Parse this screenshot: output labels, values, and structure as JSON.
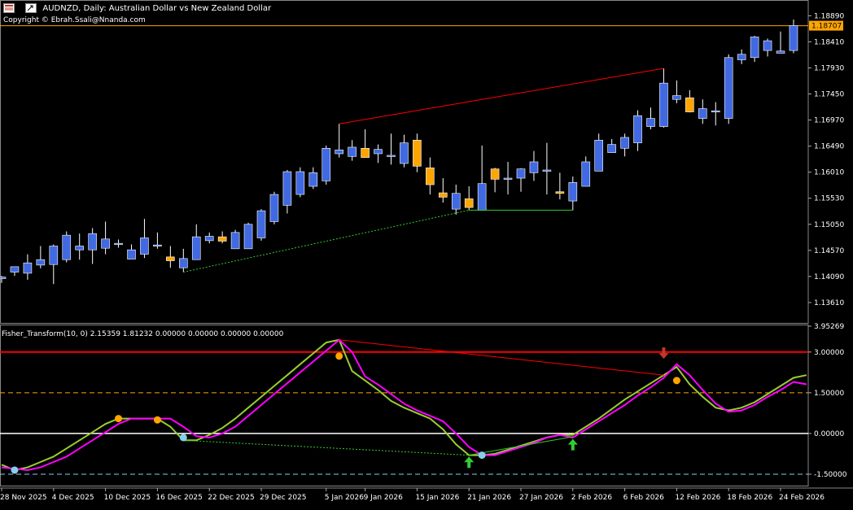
{
  "header": {
    "symbol": "AUDNZD",
    "timeframe": "Daily",
    "description": "Australian Dollar vs New Zealand Dollar",
    "title_line": "AUDNZD, Daily:  Australian Dollar vs New Zealand Dollar",
    "copyright": "Copyright © Ebrah.Ssali@Nnanda.com",
    "window_icon": "chart-window-icon",
    "restore_icon": "restore-window-icon"
  },
  "indicator_header": "Fisher_Transform(10, 0) 2.15359 1.81232 0.00000 0.00000 0.00000 0.00000",
  "colors": {
    "background": "#000000",
    "bull_candle": "#4169E1",
    "bear_candle": "#FFA500",
    "wick": "#FFFFFF",
    "price_line": "#FFA500",
    "fisher_line": "#9ACD32",
    "signal_line": "#FF00FF",
    "level_top": "#FF0000",
    "level_mid": "#FFA500",
    "level_zero": "#FFFFFF",
    "level_bottom": "#87CEEB",
    "divergence_bear": "#FF0000",
    "divergence_bull": "#32CD32",
    "dot_orange": "#FFA500",
    "dot_blue": "#87CEEB",
    "arrow_up": "#32CD32",
    "arrow_down": "#C0392B"
  },
  "chart_data": [
    {
      "type": "candlestick",
      "title": "AUDNZD, Daily",
      "current_price": "1.18707",
      "price_axis_ticks": [
        "1.18890",
        "1.18410",
        "1.17930",
        "1.17450",
        "1.16970",
        "1.16490",
        "1.16010",
        "1.15530",
        "1.15050",
        "1.14570",
        "1.14090",
        "1.13610"
      ],
      "ylim": [
        1.1322,
        1.1915
      ],
      "date_axis_ticks": [
        "28 Nov 2025",
        "4 Dec 2025",
        "10 Dec 2025",
        "16 Dec 2025",
        "22 Dec 2025",
        "29 Dec 2025",
        "5 Jan 2026",
        "9 Jan 2026",
        "15 Jan 2026",
        "21 Jan 2026",
        "27 Jan 2026",
        "2 Feb 2026",
        "6 Feb 2026",
        "12 Feb 2026",
        "18 Feb 2026",
        "24 Feb 2026"
      ],
      "candles": [
        {
          "o": 1.1405,
          "h": 1.141,
          "l": 1.1397,
          "c": 1.1408
        },
        {
          "o": 1.1417,
          "h": 1.1427,
          "l": 1.141,
          "c": 1.1427
        },
        {
          "o": 1.1415,
          "h": 1.145,
          "l": 1.1403,
          "c": 1.1434
        },
        {
          "o": 1.143,
          "h": 1.1465,
          "l": 1.1424,
          "c": 1.144
        },
        {
          "o": 1.1431,
          "h": 1.1468,
          "l": 1.1395,
          "c": 1.1465
        },
        {
          "o": 1.144,
          "h": 1.1492,
          "l": 1.1435,
          "c": 1.1485
        },
        {
          "o": 1.1458,
          "h": 1.1488,
          "l": 1.144,
          "c": 1.1465
        },
        {
          "o": 1.1458,
          "h": 1.1498,
          "l": 1.1432,
          "c": 1.1488
        },
        {
          "o": 1.1461,
          "h": 1.151,
          "l": 1.145,
          "c": 1.1478
        },
        {
          "o": 1.147,
          "h": 1.1477,
          "l": 1.1462,
          "c": 1.147
        },
        {
          "o": 1.1441,
          "h": 1.1468,
          "l": 1.1441,
          "c": 1.1458
        },
        {
          "o": 1.145,
          "h": 1.1515,
          "l": 1.1443,
          "c": 1.148
        },
        {
          "o": 1.1467,
          "h": 1.149,
          "l": 1.146,
          "c": 1.1467
        },
        {
          "o": 1.1445,
          "h": 1.1465,
          "l": 1.1425,
          "c": 1.1438
        },
        {
          "o": 1.1425,
          "h": 1.146,
          "l": 1.1417,
          "c": 1.1442
        },
        {
          "o": 1.144,
          "h": 1.1505,
          "l": 1.144,
          "c": 1.1482
        },
        {
          "o": 1.1475,
          "h": 1.149,
          "l": 1.147,
          "c": 1.1483
        },
        {
          "o": 1.1482,
          "h": 1.1492,
          "l": 1.147,
          "c": 1.1474
        },
        {
          "o": 1.146,
          "h": 1.1495,
          "l": 1.146,
          "c": 1.149
        },
        {
          "o": 1.146,
          "h": 1.1508,
          "l": 1.146,
          "c": 1.1505
        },
        {
          "o": 1.148,
          "h": 1.1533,
          "l": 1.1475,
          "c": 1.153
        },
        {
          "o": 1.151,
          "h": 1.1565,
          "l": 1.1505,
          "c": 1.156
        },
        {
          "o": 1.154,
          "h": 1.1605,
          "l": 1.1525,
          "c": 1.1602
        },
        {
          "o": 1.156,
          "h": 1.161,
          "l": 1.1555,
          "c": 1.1602
        },
        {
          "o": 1.1575,
          "h": 1.161,
          "l": 1.157,
          "c": 1.16
        },
        {
          "o": 1.1585,
          "h": 1.165,
          "l": 1.1578,
          "c": 1.1645
        },
        {
          "o": 1.1635,
          "h": 1.169,
          "l": 1.1628,
          "c": 1.1642
        },
        {
          "o": 1.163,
          "h": 1.166,
          "l": 1.1622,
          "c": 1.1647
        },
        {
          "o": 1.1645,
          "h": 1.168,
          "l": 1.163,
          "c": 1.1628
        },
        {
          "o": 1.1635,
          "h": 1.1652,
          "l": 1.1618,
          "c": 1.1643
        },
        {
          "o": 1.163,
          "h": 1.1672,
          "l": 1.1615,
          "c": 1.1632
        },
        {
          "o": 1.1617,
          "h": 1.167,
          "l": 1.161,
          "c": 1.1655
        },
        {
          "o": 1.166,
          "h": 1.1672,
          "l": 1.1601,
          "c": 1.1612
        },
        {
          "o": 1.1609,
          "h": 1.1628,
          "l": 1.156,
          "c": 1.1578
        },
        {
          "o": 1.1563,
          "h": 1.159,
          "l": 1.1545,
          "c": 1.1555
        },
        {
          "o": 1.1533,
          "h": 1.1578,
          "l": 1.1523,
          "c": 1.1562
        },
        {
          "o": 1.1552,
          "h": 1.1575,
          "l": 1.1531,
          "c": 1.1536
        },
        {
          "o": 1.1531,
          "h": 1.165,
          "l": 1.1531,
          "c": 1.158
        },
        {
          "o": 1.1607,
          "h": 1.1609,
          "l": 1.1564,
          "c": 1.1588
        },
        {
          "o": 1.159,
          "h": 1.162,
          "l": 1.156,
          "c": 1.159
        },
        {
          "o": 1.159,
          "h": 1.1608,
          "l": 1.1565,
          "c": 1.1607
        },
        {
          "o": 1.16,
          "h": 1.164,
          "l": 1.1585,
          "c": 1.162
        },
        {
          "o": 1.1605,
          "h": 1.1655,
          "l": 1.156,
          "c": 1.1605
        },
        {
          "o": 1.1565,
          "h": 1.16,
          "l": 1.1551,
          "c": 1.1562
        },
        {
          "o": 1.1548,
          "h": 1.1593,
          "l": 1.1531,
          "c": 1.1582
        },
        {
          "o": 1.1575,
          "h": 1.163,
          "l": 1.1575,
          "c": 1.162
        },
        {
          "o": 1.1603,
          "h": 1.1672,
          "l": 1.1603,
          "c": 1.166
        },
        {
          "o": 1.1637,
          "h": 1.1662,
          "l": 1.1637,
          "c": 1.1652
        },
        {
          "o": 1.1645,
          "h": 1.1672,
          "l": 1.163,
          "c": 1.1665
        },
        {
          "o": 1.1655,
          "h": 1.1715,
          "l": 1.164,
          "c": 1.1705
        },
        {
          "o": 1.1685,
          "h": 1.172,
          "l": 1.168,
          "c": 1.17
        },
        {
          "o": 1.1685,
          "h": 1.1792,
          "l": 1.1683,
          "c": 1.1765
        },
        {
          "o": 1.1735,
          "h": 1.177,
          "l": 1.1728,
          "c": 1.1742
        },
        {
          "o": 1.1738,
          "h": 1.1752,
          "l": 1.1711,
          "c": 1.1712
        },
        {
          "o": 1.17,
          "h": 1.1735,
          "l": 1.169,
          "c": 1.1718
        },
        {
          "o": 1.1712,
          "h": 1.173,
          "l": 1.1687,
          "c": 1.1714
        },
        {
          "o": 1.17,
          "h": 1.1818,
          "l": 1.169,
          "c": 1.1812
        },
        {
          "o": 1.1808,
          "h": 1.1827,
          "l": 1.18,
          "c": 1.1818
        },
        {
          "o": 1.1812,
          "h": 1.1852,
          "l": 1.1804,
          "c": 1.185
        },
        {
          "o": 1.1825,
          "h": 1.1847,
          "l": 1.1814,
          "c": 1.1843
        },
        {
          "o": 1.182,
          "h": 1.186,
          "l": 1.1823,
          "c": 1.1824
        },
        {
          "o": 1.1825,
          "h": 1.1882,
          "l": 1.182,
          "c": 1.1871
        }
      ]
    },
    {
      "type": "line",
      "title": "Fisher_Transform(10, 0)",
      "axis_ticks": [
        "3.95269",
        "3.00000",
        "1.50000",
        "0.00000",
        "-1.50000"
      ],
      "ylim": [
        -1.95,
        3.95269
      ],
      "levels": [
        3.0,
        1.5,
        0.0,
        -1.5
      ],
      "series": [
        {
          "values": [
            -1.15,
            -1.35,
            -1.25,
            -1.05,
            -0.85,
            -0.55,
            -0.25,
            0.05,
            0.35,
            0.55,
            0.55,
            0.55,
            0.55,
            0.25,
            -0.25,
            -0.25,
            -0.05,
            0.2,
            0.55,
            0.95,
            1.35,
            1.75,
            2.15,
            2.55,
            2.95,
            3.35,
            3.45,
            2.3,
            1.95,
            1.6,
            1.2,
            0.95,
            0.75,
            0.55,
            0.15,
            -0.4,
            -0.8,
            -0.8,
            -0.75,
            -0.6,
            -0.45,
            -0.3,
            -0.15,
            -0.05,
            -0.05,
            0.25,
            0.55,
            0.9,
            1.25,
            1.55,
            1.85,
            2.15,
            2.45,
            1.81,
            1.35,
            0.95,
            0.85,
            0.95,
            1.15,
            1.45,
            1.75,
            2.05,
            2.15
          ]
        },
        {
          "values": [
            -1.25,
            -1.3,
            -1.35,
            -1.25,
            -1.05,
            -0.85,
            -0.55,
            -0.25,
            0.05,
            0.35,
            0.55,
            0.55,
            0.55,
            0.55,
            0.25,
            -0.1,
            -0.15,
            0.0,
            0.25,
            0.65,
            1.05,
            1.45,
            1.85,
            2.25,
            2.65,
            3.05,
            3.45,
            3.0,
            2.1,
            1.8,
            1.45,
            1.1,
            0.85,
            0.65,
            0.45,
            0.0,
            -0.5,
            -0.8,
            -0.8,
            -0.65,
            -0.5,
            -0.35,
            -0.15,
            -0.05,
            -0.15,
            0.15,
            0.45,
            0.75,
            1.05,
            1.4,
            1.7,
            2.05,
            2.55,
            2.15,
            1.6,
            1.1,
            0.8,
            0.85,
            1.05,
            1.35,
            1.6,
            1.9,
            1.81
          ]
        }
      ]
    }
  ]
}
